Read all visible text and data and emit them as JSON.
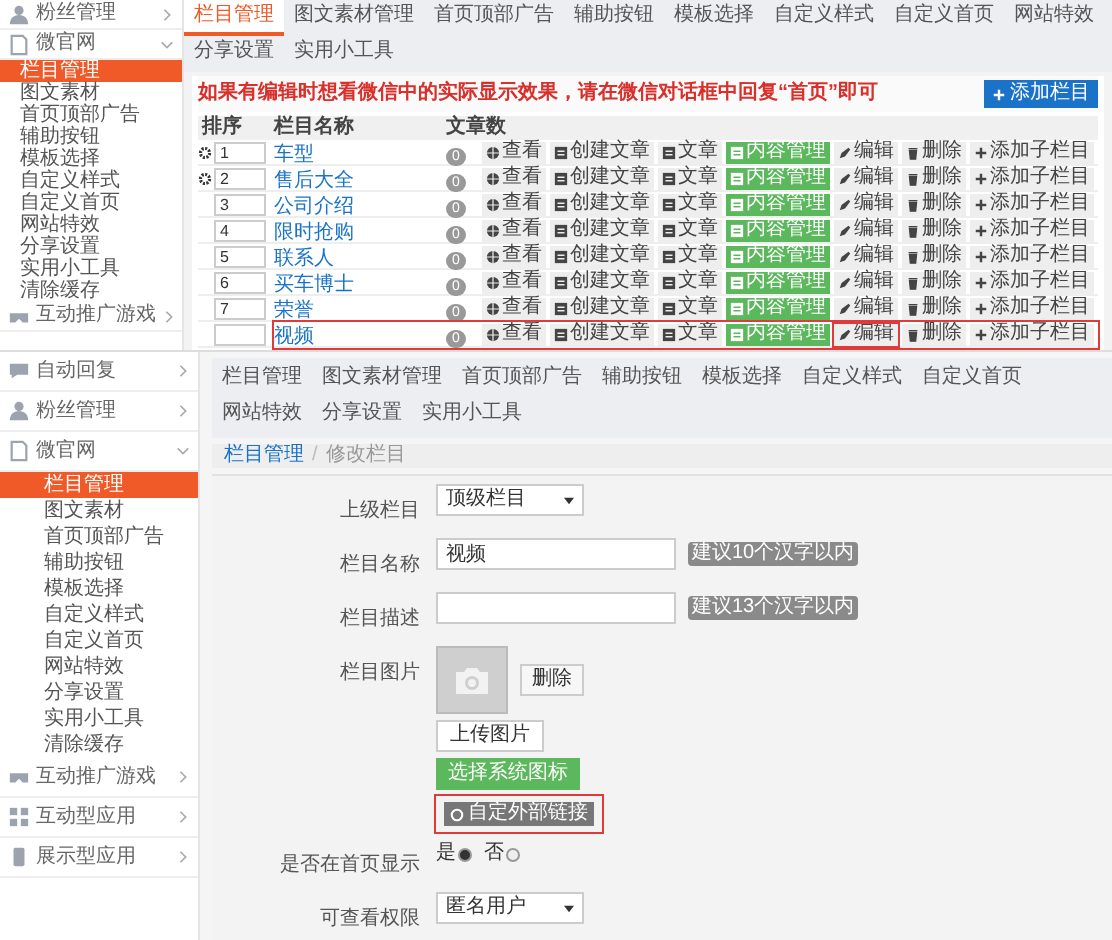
{
  "list_view": {
    "sidebar": {
      "items": [
        {
          "label": "粉丝管理",
          "expanded": false
        },
        {
          "label": "微官网",
          "expanded": true,
          "children": [
            {
              "label": "栏目管理",
              "selected": true
            },
            {
              "label": "图文素材",
              "selected": false
            },
            {
              "label": "首页顶部广告",
              "selected": false
            },
            {
              "label": "辅助按钮",
              "selected": false
            },
            {
              "label": "模板选择",
              "selected": false
            },
            {
              "label": "自定义样式",
              "selected": false
            },
            {
              "label": "自定义首页",
              "selected": false
            },
            {
              "label": "网站特效",
              "selected": false
            },
            {
              "label": "分享设置",
              "selected": false
            },
            {
              "label": "实用小工具",
              "selected": false
            },
            {
              "label": "清除缓存",
              "selected": false
            }
          ]
        },
        {
          "label": "互动推广游戏",
          "expanded": false
        }
      ]
    },
    "tabs": [
      {
        "label": "栏目管理",
        "selected": true
      },
      {
        "label": "图文素材管理",
        "selected": false
      },
      {
        "label": "首页顶部广告",
        "selected": false
      },
      {
        "label": "辅助按钮",
        "selected": false
      },
      {
        "label": "模板选择",
        "selected": false
      },
      {
        "label": "自定义样式",
        "selected": false
      },
      {
        "label": "自定义首页",
        "selected": false
      },
      {
        "label": "网站特效",
        "selected": false
      },
      {
        "label": "分享设置",
        "selected": false
      },
      {
        "label": "实用小工具",
        "selected": false
      }
    ],
    "notice": "如果有编辑时想看微信中的实际显示效果，请在微信对话框中回复“首页”即可",
    "add_button": "添加栏目",
    "table": {
      "columns": [
        "排序",
        "栏目名称",
        "文章数"
      ],
      "rows": [
        {
          "sort": "1",
          "name": "车型",
          "count": "0",
          "expandable": true,
          "highlighted": false,
          "actions": [
            {
              "kind": "view",
              "label": "查看",
              "highlighted": false
            },
            {
              "kind": "create",
              "label": "创建文章",
              "highlighted": false
            },
            {
              "kind": "article",
              "label": "文章",
              "highlighted": false
            },
            {
              "kind": "manage",
              "label": "内容管理",
              "highlighted": false
            },
            {
              "kind": "edit",
              "label": "编辑",
              "highlighted": false
            },
            {
              "kind": "delete",
              "label": "删除",
              "highlighted": false
            },
            {
              "kind": "add_child",
              "label": "添加子栏目",
              "highlighted": false
            }
          ]
        },
        {
          "sort": "2",
          "name": "售后大全",
          "count": "0",
          "expandable": true,
          "highlighted": false,
          "actions": [
            {
              "kind": "view",
              "label": "查看",
              "highlighted": false
            },
            {
              "kind": "create",
              "label": "创建文章",
              "highlighted": false
            },
            {
              "kind": "article",
              "label": "文章",
              "highlighted": false
            },
            {
              "kind": "manage",
              "label": "内容管理",
              "highlighted": false
            },
            {
              "kind": "edit",
              "label": "编辑",
              "highlighted": false
            },
            {
              "kind": "delete",
              "label": "删除",
              "highlighted": false
            },
            {
              "kind": "add_child",
              "label": "添加子栏目",
              "highlighted": false
            }
          ]
        },
        {
          "sort": "3",
          "name": "公司介绍",
          "count": "0",
          "expandable": false,
          "highlighted": false,
          "actions": [
            {
              "kind": "view",
              "label": "查看",
              "highlighted": false
            },
            {
              "kind": "create",
              "label": "创建文章",
              "highlighted": false
            },
            {
              "kind": "article",
              "label": "文章",
              "highlighted": false
            },
            {
              "kind": "manage",
              "label": "内容管理",
              "highlighted": false
            },
            {
              "kind": "edit",
              "label": "编辑",
              "highlighted": false
            },
            {
              "kind": "delete",
              "label": "删除",
              "highlighted": false
            },
            {
              "kind": "add_child",
              "label": "添加子栏目",
              "highlighted": false
            }
          ]
        },
        {
          "sort": "4",
          "name": "限时抢购",
          "count": "0",
          "expandable": false,
          "highlighted": false,
          "actions": [
            {
              "kind": "view",
              "label": "查看",
              "highlighted": false
            },
            {
              "kind": "create",
              "label": "创建文章",
              "highlighted": false
            },
            {
              "kind": "article",
              "label": "文章",
              "highlighted": false
            },
            {
              "kind": "manage",
              "label": "内容管理",
              "highlighted": false
            },
            {
              "kind": "edit",
              "label": "编辑",
              "highlighted": false
            },
            {
              "kind": "delete",
              "label": "删除",
              "highlighted": false
            },
            {
              "kind": "add_child",
              "label": "添加子栏目",
              "highlighted": false
            }
          ]
        },
        {
          "sort": "5",
          "name": "联系人",
          "count": "0",
          "expandable": false,
          "highlighted": false,
          "actions": [
            {
              "kind": "view",
              "label": "查看",
              "highlighted": false
            },
            {
              "kind": "create",
              "label": "创建文章",
              "highlighted": false
            },
            {
              "kind": "article",
              "label": "文章",
              "highlighted": false
            },
            {
              "kind": "manage",
              "label": "内容管理",
              "highlighted": false
            },
            {
              "kind": "edit",
              "label": "编辑",
              "highlighted": false
            },
            {
              "kind": "delete",
              "label": "删除",
              "highlighted": false
            },
            {
              "kind": "add_child",
              "label": "添加子栏目",
              "highlighted": false
            }
          ]
        },
        {
          "sort": "6",
          "name": "买车博士",
          "count": "0",
          "expandable": false,
          "highlighted": false,
          "actions": [
            {
              "kind": "view",
              "label": "查看",
              "highlighted": false
            },
            {
              "kind": "create",
              "label": "创建文章",
              "highlighted": false
            },
            {
              "kind": "article",
              "label": "文章",
              "highlighted": false
            },
            {
              "kind": "manage",
              "label": "内容管理",
              "highlighted": false
            },
            {
              "kind": "edit",
              "label": "编辑",
              "highlighted": false
            },
            {
              "kind": "delete",
              "label": "删除",
              "highlighted": false
            },
            {
              "kind": "add_child",
              "label": "添加子栏目",
              "highlighted": false
            }
          ]
        },
        {
          "sort": "7",
          "name": "荣誉",
          "count": "0",
          "expandable": false,
          "highlighted": false,
          "actions": [
            {
              "kind": "view",
              "label": "查看",
              "highlighted": false
            },
            {
              "kind": "create",
              "label": "创建文章",
              "highlighted": false
            },
            {
              "kind": "article",
              "label": "文章",
              "highlighted": false
            },
            {
              "kind": "manage",
              "label": "内容管理",
              "highlighted": false
            },
            {
              "kind": "edit",
              "label": "编辑",
              "highlighted": false
            },
            {
              "kind": "delete",
              "label": "删除",
              "highlighted": false
            },
            {
              "kind": "add_child",
              "label": "添加子栏目",
              "highlighted": false
            }
          ]
        },
        {
          "name": "视频",
          "count": "0",
          "expandable": false,
          "highlighted": true,
          "actions": [
            {
              "kind": "view",
              "label": "查看",
              "highlighted": false
            },
            {
              "kind": "create",
              "label": "创建文章",
              "highlighted": false
            },
            {
              "kind": "article",
              "label": "文章",
              "highlighted": false
            },
            {
              "kind": "manage",
              "label": "内容管理",
              "highlighted": false
            },
            {
              "kind": "edit",
              "label": "编辑",
              "highlighted": true
            },
            {
              "kind": "delete",
              "label": "删除",
              "highlighted": false
            },
            {
              "kind": "add_child",
              "label": "添加子栏目",
              "highlighted": false
            }
          ]
        }
      ]
    }
  },
  "edit_view": {
    "sidebar": {
      "items": [
        {
          "label": "自动回复",
          "expanded": false
        },
        {
          "label": "粉丝管理",
          "expanded": false
        },
        {
          "label": "微官网",
          "expanded": true,
          "children": [
            {
              "label": "栏目管理",
              "selected": true
            },
            {
              "label": "图文素材",
              "selected": false
            },
            {
              "label": "首页顶部广告",
              "selected": false
            },
            {
              "label": "辅助按钮",
              "selected": false
            },
            {
              "label": "模板选择",
              "selected": false
            },
            {
              "label": "自定义样式",
              "selected": false
            },
            {
              "label": "自定义首页",
              "selected": false
            },
            {
              "label": "网站特效",
              "selected": false
            },
            {
              "label": "分享设置",
              "selected": false
            },
            {
              "label": "实用小工具",
              "selected": false
            },
            {
              "label": "清除缓存",
              "selected": false
            }
          ]
        },
        {
          "label": "互动推广游戏",
          "expanded": false
        },
        {
          "label": "互动型应用",
          "expanded": false
        },
        {
          "label": "展示型应用",
          "expanded": false
        }
      ]
    },
    "tabs": [
      {
        "label": "栏目管理",
        "selected": false
      },
      {
        "label": "图文素材管理",
        "selected": false
      },
      {
        "label": "首页顶部广告",
        "selected": false
      },
      {
        "label": "辅助按钮",
        "selected": false
      },
      {
        "label": "模板选择",
        "selected": false
      },
      {
        "label": "自定义样式",
        "selected": false
      },
      {
        "label": "自定义首页",
        "selected": false
      },
      {
        "label": "网站特效",
        "selected": false
      },
      {
        "label": "分享设置",
        "selected": false
      },
      {
        "label": "实用小工具",
        "selected": false
      }
    ],
    "breadcrumb": {
      "items": [
        "栏目管理",
        "修改栏目"
      ],
      "separator": "/"
    },
    "form": [
      {
        "kind": "select",
        "label": "上级栏目",
        "value": "顶级栏目"
      },
      {
        "kind": "text",
        "label": "栏目名称",
        "value": "视频",
        "hint": "建议10个汉字以内"
      },
      {
        "kind": "text",
        "label": "栏目描述",
        "hint": "建议13个汉字以内"
      },
      {
        "kind": "image",
        "label": "栏目图片",
        "button": "删除"
      },
      {
        "kind": "button",
        "text": "上传图片"
      },
      {
        "kind": "green_button",
        "text": "选择系统图标"
      },
      {
        "kind": "badge",
        "text": "自定外部链接",
        "highlighted": true
      },
      {
        "kind": "radio",
        "label": "是否在首页显示",
        "options": [
          {
            "label": "是",
            "selected": true
          },
          {
            "label": "否",
            "selected": false
          }
        ]
      },
      {
        "kind": "select",
        "label": "可查看权限",
        "value": "匿名用户"
      }
    ]
  }
}
